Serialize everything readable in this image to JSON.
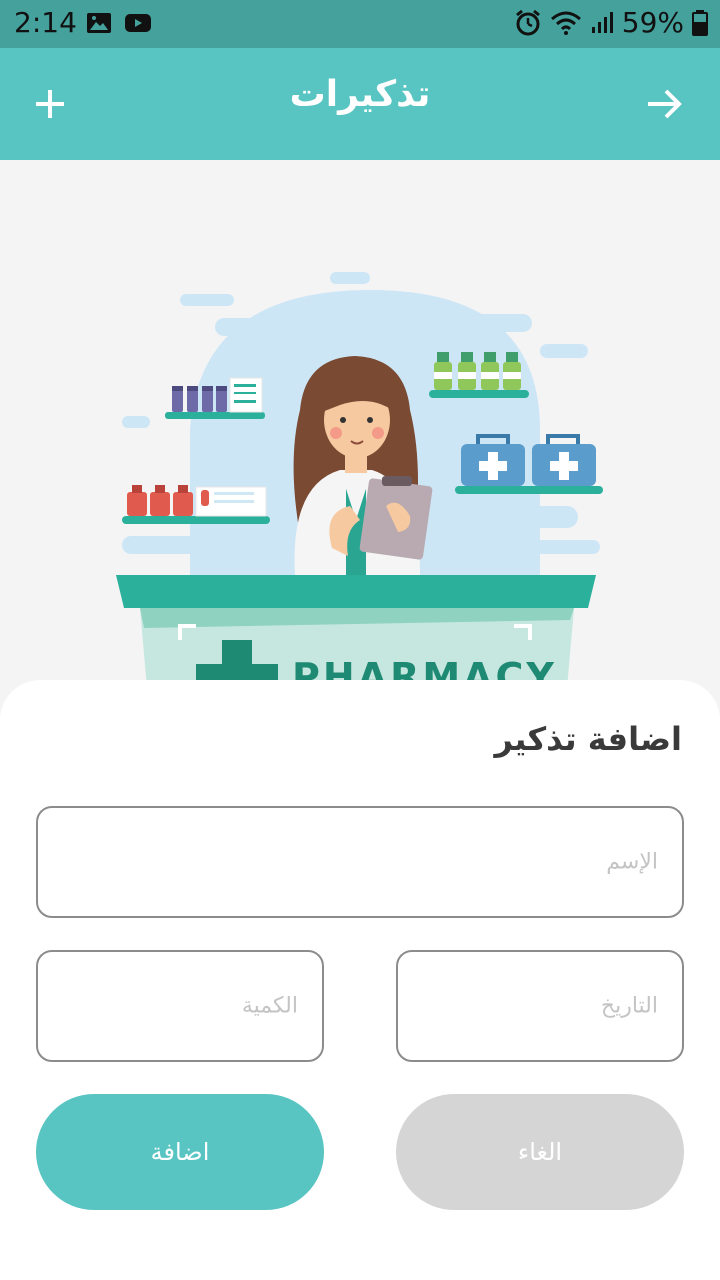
{
  "status_bar": {
    "time": "2:14",
    "battery": "59%",
    "icons": [
      "image-icon",
      "youtube-icon",
      "alarm-icon",
      "wifi-icon",
      "signal-icon",
      "battery-icon"
    ]
  },
  "app_bar": {
    "title": "تذكيرات",
    "add_icon": "plus-icon",
    "back_icon": "arrow-right-icon"
  },
  "illustration": {
    "sign_text": "PHARMACY"
  },
  "sheet": {
    "title": "اضافة تذكير",
    "name_placeholder": "الإسم",
    "date_placeholder": "التاريخ",
    "quantity_placeholder": "الكمية",
    "add_label": "اضافة",
    "cancel_label": "الغاء"
  },
  "colors": {
    "status_bar": "#45a19c",
    "primary": "#58c5c3",
    "cancel_button": "#d5d5d5",
    "teal_dark": "#2bb09b"
  }
}
